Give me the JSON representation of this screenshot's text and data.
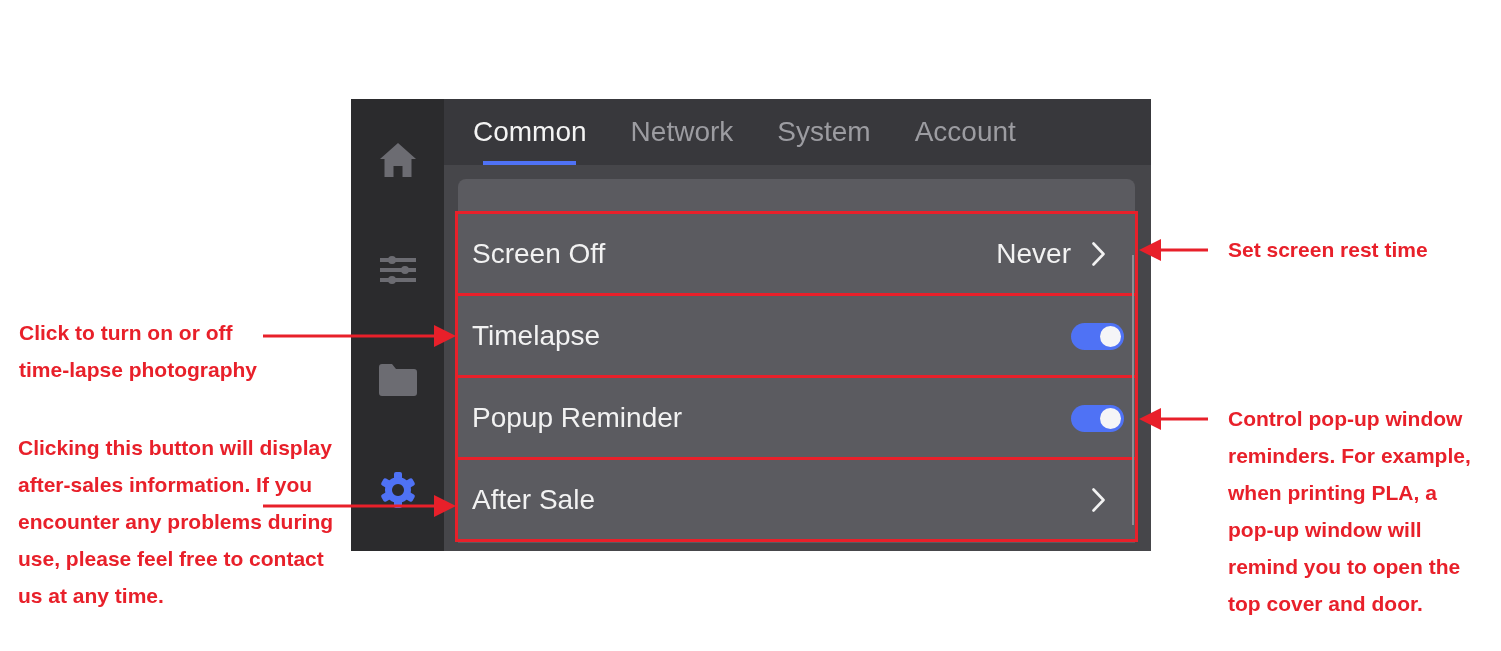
{
  "screen": {
    "sidebar": {
      "items": [
        {
          "selected": false
        },
        {
          "selected": false
        },
        {
          "selected": false
        },
        {
          "selected": true
        }
      ]
    },
    "tabs": [
      {
        "label": "Common",
        "selected": true
      },
      {
        "label": "Network",
        "selected": false
      },
      {
        "label": "System",
        "selected": false
      },
      {
        "label": "Account",
        "selected": false
      }
    ],
    "rows": [
      {
        "kind": "link",
        "label": "Screen Off",
        "value": "Never",
        "highlighted": true
      },
      {
        "kind": "toggle",
        "label": "Timelapse",
        "on": true,
        "highlighted": true
      },
      {
        "kind": "toggle",
        "label": "Popup Reminder",
        "on": true,
        "highlighted": true
      },
      {
        "kind": "link",
        "label": "After Sale",
        "highlighted": true
      }
    ]
  },
  "left_callouts": [
    {
      "text": "Click to turn on or off\ntime-lapse photography"
    },
    {
      "text": "Clicking this button will display\nafter-sales information. If you\nencounter any problems during\nuse, please feel free to contact\nus at any time."
    }
  ],
  "right_callouts": [
    {
      "text": "Set screen rest time"
    },
    {
      "text": "Control pop-up window\nreminders. For example,\nwhen printing PLA, a\npop-up window will\nremind you to open the\ntop cover and door."
    }
  ]
}
